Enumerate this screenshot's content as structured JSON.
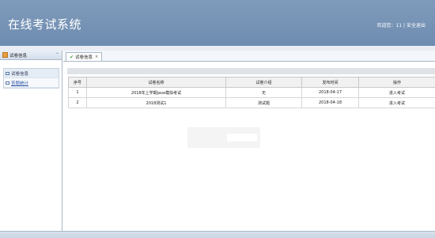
{
  "header": {
    "title": "在线考试系统",
    "welcome": "欢迎您：11",
    "logout": "安全退出"
  },
  "sidebar": {
    "title": "试卷信息",
    "items": [
      {
        "label": "试卷信息"
      },
      {
        "label": "答题统计"
      }
    ]
  },
  "tabs": [
    {
      "label": "试卷信息"
    }
  ],
  "table": {
    "columns": [
      "序号",
      "试卷名称",
      "试卷介绍",
      "发布时间",
      "操作"
    ],
    "rows": [
      {
        "no": "1",
        "name": "2018年上学期java模拟考试",
        "intro": "无",
        "date": "2018-04-17",
        "action": "进入考试"
      },
      {
        "no": "2",
        "name": "2018测试1",
        "intro": "测试题",
        "date": "2018-04-18",
        "action": "进入考试"
      }
    ]
  },
  "colors": {
    "header_bg": "#7490b4",
    "action_red": "#e03030"
  }
}
